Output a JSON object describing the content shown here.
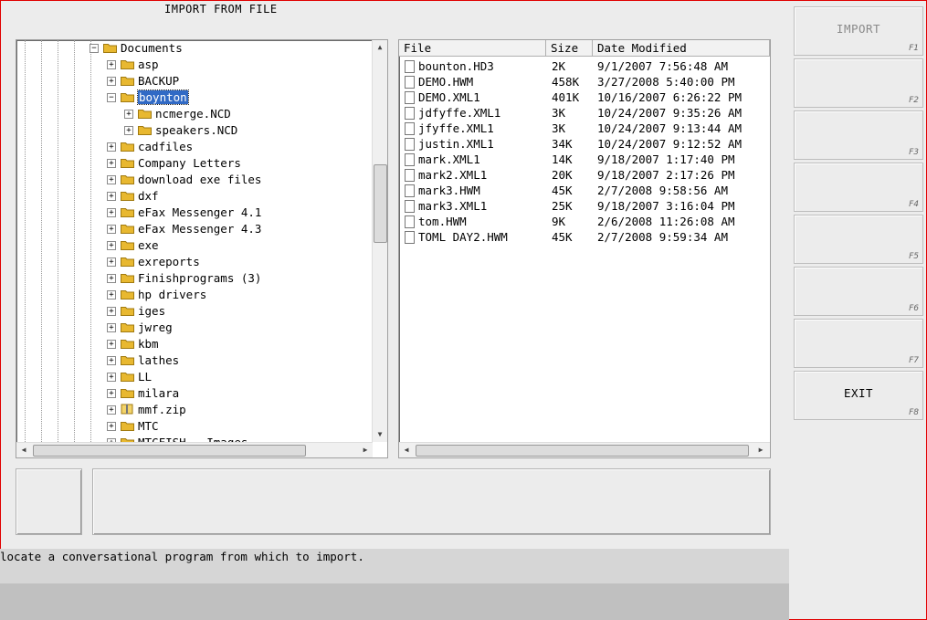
{
  "window_title": "IMPORT FROM FILE",
  "tree": {
    "root": "Documents",
    "items": [
      {
        "label": "asp",
        "depth": 1,
        "expander": "+"
      },
      {
        "label": "BACKUP",
        "depth": 1,
        "expander": "+"
      },
      {
        "label": "boynton",
        "depth": 1,
        "expander": "-",
        "selected": true
      },
      {
        "label": "ncmerge.NCD",
        "depth": 2,
        "expander": "+"
      },
      {
        "label": "speakers.NCD",
        "depth": 2,
        "expander": "+"
      },
      {
        "label": "cadfiles",
        "depth": 1,
        "expander": "+"
      },
      {
        "label": "Company Letters",
        "depth": 1,
        "expander": "+"
      },
      {
        "label": "download exe files",
        "depth": 1,
        "expander": "+"
      },
      {
        "label": "dxf",
        "depth": 1,
        "expander": "+"
      },
      {
        "label": "eFax Messenger 4.1",
        "depth": 1,
        "expander": "+"
      },
      {
        "label": "eFax Messenger 4.3",
        "depth": 1,
        "expander": "+"
      },
      {
        "label": "exe",
        "depth": 1,
        "expander": "+"
      },
      {
        "label": "exreports",
        "depth": 1,
        "expander": "+"
      },
      {
        "label": "Finishprograms (3)",
        "depth": 1,
        "expander": "+"
      },
      {
        "label": "hp drivers",
        "depth": 1,
        "expander": "+"
      },
      {
        "label": "iges",
        "depth": 1,
        "expander": "+"
      },
      {
        "label": "jwreg",
        "depth": 1,
        "expander": "+"
      },
      {
        "label": "kbm",
        "depth": 1,
        "expander": "+"
      },
      {
        "label": "lathes",
        "depth": 1,
        "expander": "+"
      },
      {
        "label": "LL",
        "depth": 1,
        "expander": "+"
      },
      {
        "label": "milara",
        "depth": 1,
        "expander": "+"
      },
      {
        "label": "mmf.zip",
        "depth": 1,
        "expander": "+",
        "zip": true
      },
      {
        "label": "MTC",
        "depth": 1,
        "expander": "+"
      },
      {
        "label": "MTCFISH - Images",
        "depth": 1,
        "expander": "+"
      }
    ]
  },
  "files": {
    "columns": [
      "File",
      "Size",
      "Date Modified"
    ],
    "rows": [
      [
        "bounton.HD3",
        "2K",
        "9/1/2007 7:56:48 AM"
      ],
      [
        "DEMO.HWM",
        "458K",
        "3/27/2008 5:40:00 PM"
      ],
      [
        "DEMO.XML1",
        "401K",
        "10/16/2007 6:26:22 PM"
      ],
      [
        "jdfyffe.XML1",
        "3K",
        "10/24/2007 9:35:26 AM"
      ],
      [
        "jfyffe.XML1",
        "3K",
        "10/24/2007 9:13:44 AM"
      ],
      [
        "justin.XML1",
        "34K",
        "10/24/2007 9:12:52 AM"
      ],
      [
        "mark.XML1",
        "14K",
        "9/18/2007 1:17:40 PM"
      ],
      [
        "mark2.XML1",
        "20K",
        "9/18/2007 2:17:26 PM"
      ],
      [
        "mark3.HWM",
        "45K",
        "2/7/2008 9:58:56 AM"
      ],
      [
        "mark3.XML1",
        "25K",
        "9/18/2007 3:16:04 PM"
      ],
      [
        "tom.HWM",
        "9K",
        "2/6/2008 11:26:08 AM"
      ],
      [
        "TOML DAY2.HWM",
        "45K",
        "2/7/2008 9:59:34 AM"
      ]
    ]
  },
  "function_keys": [
    {
      "label": "IMPORT",
      "key": "F1",
      "disabled": true
    },
    {
      "label": "",
      "key": "F2"
    },
    {
      "label": "",
      "key": "F3"
    },
    {
      "label": "",
      "key": "F4"
    },
    {
      "label": "",
      "key": "F5"
    },
    {
      "label": "",
      "key": "F6"
    },
    {
      "label": "",
      "key": "F7"
    },
    {
      "label": "EXIT",
      "key": "F8"
    }
  ],
  "status_message": "locate a conversational program from which to import.",
  "colors": {
    "selection": "#316ac5",
    "folder": "#e8b830",
    "frame": "#e00000"
  }
}
